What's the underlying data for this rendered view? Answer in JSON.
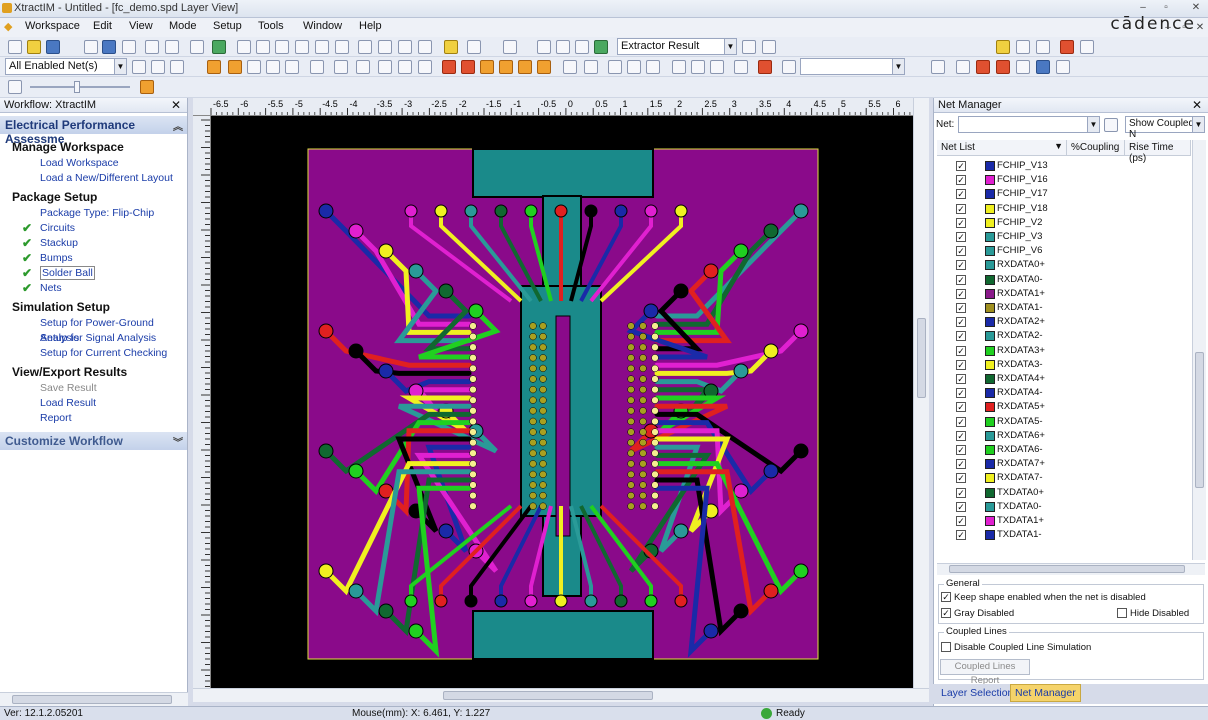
{
  "window": {
    "title": "XtractIM - Untitled - [fc_demo.spd Layer View]"
  },
  "menu": [
    "Workspace",
    "Edit",
    "View",
    "Mode",
    "Setup",
    "Tools",
    "Window",
    "Help"
  ],
  "brand": "cādence",
  "toolbar": {
    "extractor_combo": "Extractor Result",
    "net_filter_combo": "All Enabled Net(s)"
  },
  "workflow": {
    "panel_title": "Workflow: XtractIM",
    "section_title": "Electrical Performance Assessme",
    "groups": [
      {
        "title": "Manage Workspace",
        "items": [
          {
            "label": "Load Workspace"
          },
          {
            "label": "Load a New/Different Layout"
          }
        ]
      },
      {
        "title": "Package Setup",
        "items": [
          {
            "label": "Package Type: Flip-Chip"
          },
          {
            "label": "Circuits"
          },
          {
            "label": "Stackup"
          },
          {
            "label": "Bumps"
          },
          {
            "label": "Solder Ball"
          },
          {
            "label": "Nets"
          }
        ]
      },
      {
        "title": "Simulation Setup",
        "items": [
          {
            "label": "Setup for Power-Ground Analysis"
          },
          {
            "label": "Setup for Signal Analysis"
          },
          {
            "label": "Setup for Current Checking"
          }
        ]
      },
      {
        "title": "View/Export Results",
        "items": [
          {
            "label": "Save Result"
          },
          {
            "label": "Load Result"
          },
          {
            "label": "Report"
          }
        ]
      }
    ],
    "customize_title": "Customize Workflow"
  },
  "ruler": {
    "top_ticks": [
      "-6.5",
      "-6",
      "-5.5",
      "-5",
      "-4.5",
      "-4",
      "-3.5",
      "-3",
      "-2.5",
      "-2",
      "-1.5",
      "-1",
      "-0.5",
      "0",
      "0.5",
      "1",
      "1.5",
      "2",
      "2.5",
      "3",
      "3.5",
      "4",
      "4.5",
      "5",
      "5.5",
      "6"
    ]
  },
  "net_manager": {
    "title": "Net Manager",
    "net_label": "Net:",
    "show_coupled": "Show Coupled N",
    "columns": [
      "Net List",
      "%Coupling",
      "Rise Time (ps)"
    ],
    "nets": [
      {
        "name": "FCHIP_V13",
        "color": "#1a2aa8"
      },
      {
        "name": "FCHIP_V16",
        "color": "#e020d0"
      },
      {
        "name": "FCHIP_V17",
        "color": "#1a2aa8"
      },
      {
        "name": "FCHIP_V18",
        "color": "#f0f020"
      },
      {
        "name": "FCHIP_V2",
        "color": "#f0f020"
      },
      {
        "name": "FCHIP_V3",
        "color": "#2a9a98"
      },
      {
        "name": "FCHIP_V6",
        "color": "#2a9a98"
      },
      {
        "name": "RXDATA0+",
        "color": "#2a9a98"
      },
      {
        "name": "RXDATA0-",
        "color": "#106830"
      },
      {
        "name": "RXDATA1+",
        "color": "#8a1a8a"
      },
      {
        "name": "RXDATA1-",
        "color": "#a09020"
      },
      {
        "name": "RXDATA2+",
        "color": "#1a2aa8"
      },
      {
        "name": "RXDATA2-",
        "color": "#2a9a98"
      },
      {
        "name": "RXDATA3+",
        "color": "#20d020"
      },
      {
        "name": "RXDATA3-",
        "color": "#f0f020"
      },
      {
        "name": "RXDATA4+",
        "color": "#106830"
      },
      {
        "name": "RXDATA4-",
        "color": "#1a2aa8"
      },
      {
        "name": "RXDATA5+",
        "color": "#e02020"
      },
      {
        "name": "RXDATA5-",
        "color": "#20d020"
      },
      {
        "name": "RXDATA6+",
        "color": "#2a9a98"
      },
      {
        "name": "RXDATA6-",
        "color": "#20d020"
      },
      {
        "name": "RXDATA7+",
        "color": "#1a2aa8"
      },
      {
        "name": "RXDATA7-",
        "color": "#f0f020"
      },
      {
        "name": "TXDATA0+",
        "color": "#106830"
      },
      {
        "name": "TXDATA0-",
        "color": "#2a9a98"
      },
      {
        "name": "TXDATA1+",
        "color": "#e020d0"
      },
      {
        "name": "TXDATA1-",
        "color": "#1a2aa8"
      }
    ],
    "general_group": "General",
    "keep_shape": "Keep shape enabled when the net is disabled",
    "gray_disabled": "Gray Disabled",
    "hide_disabled": "Hide Disabled",
    "coupled_group": "Coupled Lines",
    "disable_coupled": "Disable Coupled Line Simulation",
    "coupled_report": "Coupled Lines Report"
  },
  "tabs": [
    "Layer Selection",
    "Net Manager"
  ],
  "status": {
    "version": "Ver: 12.1.2.05201",
    "mouse": "Mouse(mm): X: 6.461, Y: 1.227",
    "state": "Ready"
  }
}
